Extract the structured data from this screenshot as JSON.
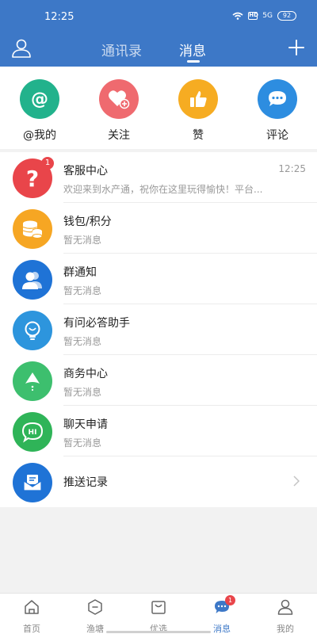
{
  "status_bar": {
    "time": "12:25",
    "hd": "HD",
    "signal": "5G",
    "battery": "92"
  },
  "nav": {
    "tab_contacts": "通讯录",
    "tab_messages": "消息",
    "active_tab": "消息"
  },
  "quick_actions": [
    {
      "label": "@我的",
      "icon": "at-icon",
      "color": "#22b28c"
    },
    {
      "label": "关注",
      "icon": "heart-plus-icon",
      "color": "#ef6a6f"
    },
    {
      "label": "赞",
      "icon": "thumbs-up-icon",
      "color": "#f6ac22"
    },
    {
      "label": "评论",
      "icon": "comment-bubble-icon",
      "color": "#2d8de0"
    }
  ],
  "messages": [
    {
      "title": "客服中心",
      "subtitle": "欢迎来到水产通，祝你在这里玩得愉快！平台...",
      "time": "12:25",
      "badge": "1",
      "icon": "question-icon",
      "color": "#e9454a"
    },
    {
      "title": "钱包/积分",
      "subtitle": "暂无消息",
      "icon": "coins-icon",
      "color": "#f6a623"
    },
    {
      "title": "群通知",
      "subtitle": "暂无消息",
      "icon": "group-icon",
      "color": "#1f73d6"
    },
    {
      "title": "有问必答助手",
      "subtitle": "暂无消息",
      "icon": "lightbulb-icon",
      "color": "#2d95dd"
    },
    {
      "title": "商务中心",
      "subtitle": "暂无消息",
      "icon": "arrow-up-icon",
      "color": "#3dbf6e"
    },
    {
      "title": "聊天申请",
      "subtitle": "暂无消息",
      "icon": "hi-bubble-icon",
      "color": "#2fb458"
    },
    {
      "title": "推送记录",
      "icon": "envelope-icon",
      "color": "#1f73d6"
    }
  ],
  "bottom_nav": [
    {
      "label": "首页",
      "icon": "home-icon"
    },
    {
      "label": "渔塘",
      "icon": "pond-icon"
    },
    {
      "label": "优选",
      "icon": "shopping-bag-icon"
    },
    {
      "label": "消息",
      "icon": "chat-icon",
      "badge": "1",
      "active": true
    },
    {
      "label": "我的",
      "icon": "person-icon"
    }
  ],
  "colors": {
    "brand": "#3d78c7",
    "badge": "#e9454a"
  }
}
